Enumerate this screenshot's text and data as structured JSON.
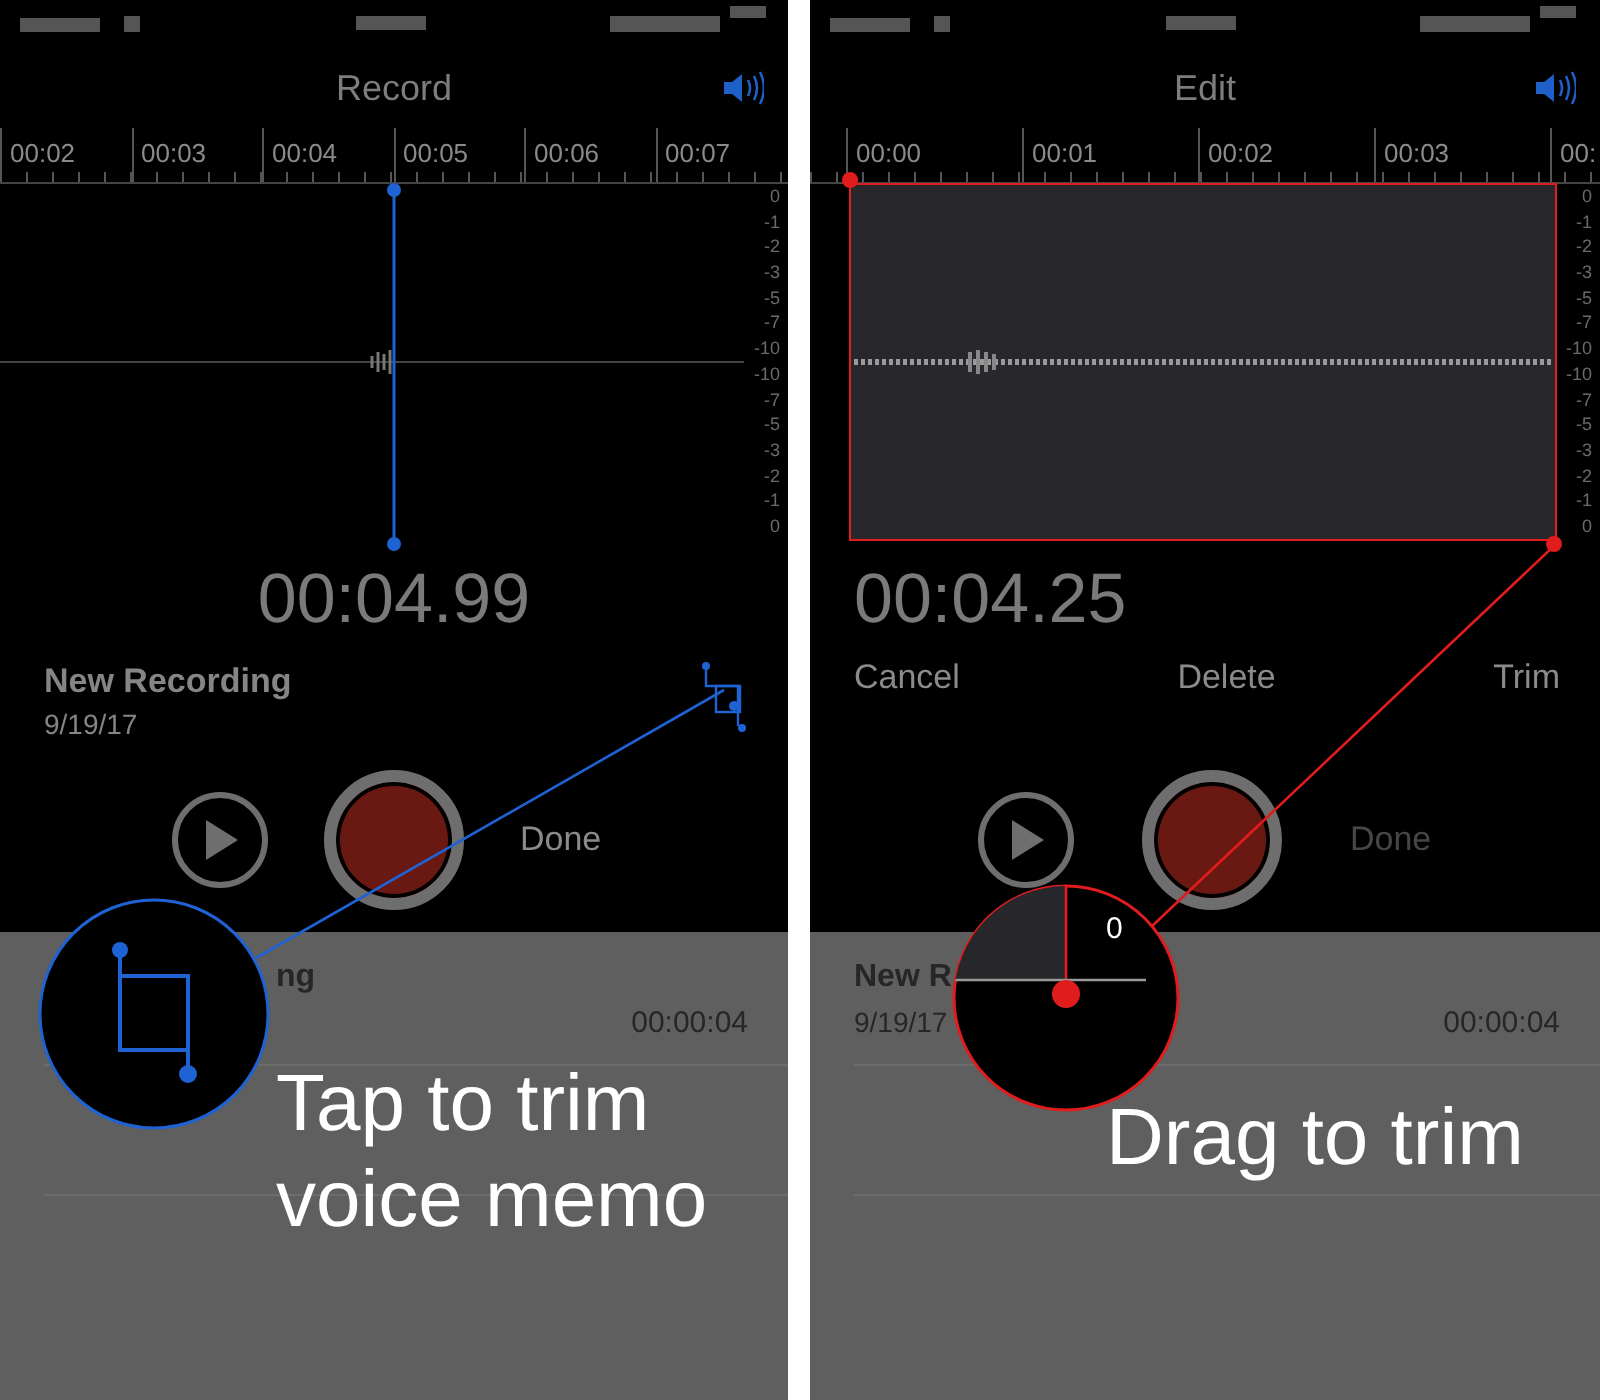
{
  "panels": [
    {
      "kind": "record",
      "title": "Record",
      "ruler": [
        "00:02",
        "00:03",
        "00:04",
        "00:05",
        "00:06",
        "00:07"
      ],
      "scale": [
        "0",
        "-1",
        "-2",
        "-3",
        "-5",
        "-7",
        "-10",
        "-10",
        "-7",
        "-5",
        "-3",
        "-2",
        "-1",
        "0"
      ],
      "time": "00:04.99",
      "recording": {
        "name": "New Recording",
        "date": "9/19/17"
      },
      "done": {
        "label": "Done",
        "disabled": false
      },
      "list": {
        "name": "ng",
        "duration": "00:00:04"
      },
      "caption": "Tap to trim voice memo"
    },
    {
      "kind": "edit",
      "title": "Edit",
      "ruler": [
        "00:00",
        "00:01",
        "00:02",
        "00:03",
        "00:"
      ],
      "scale": [
        "0",
        "-1",
        "-2",
        "-3",
        "-5",
        "-7",
        "-10",
        "-10",
        "-7",
        "-5",
        "-3",
        "-2",
        "-1",
        "0"
      ],
      "time": "00:04.25",
      "actions": [
        "Cancel",
        "Delete",
        "Trim"
      ],
      "done": {
        "label": "Done",
        "disabled": true
      },
      "list": {
        "name": "New R",
        "date": "9/19/17",
        "duration": "00:00:04"
      },
      "caption": "Drag to trim",
      "zoom_label": "0"
    }
  ]
}
